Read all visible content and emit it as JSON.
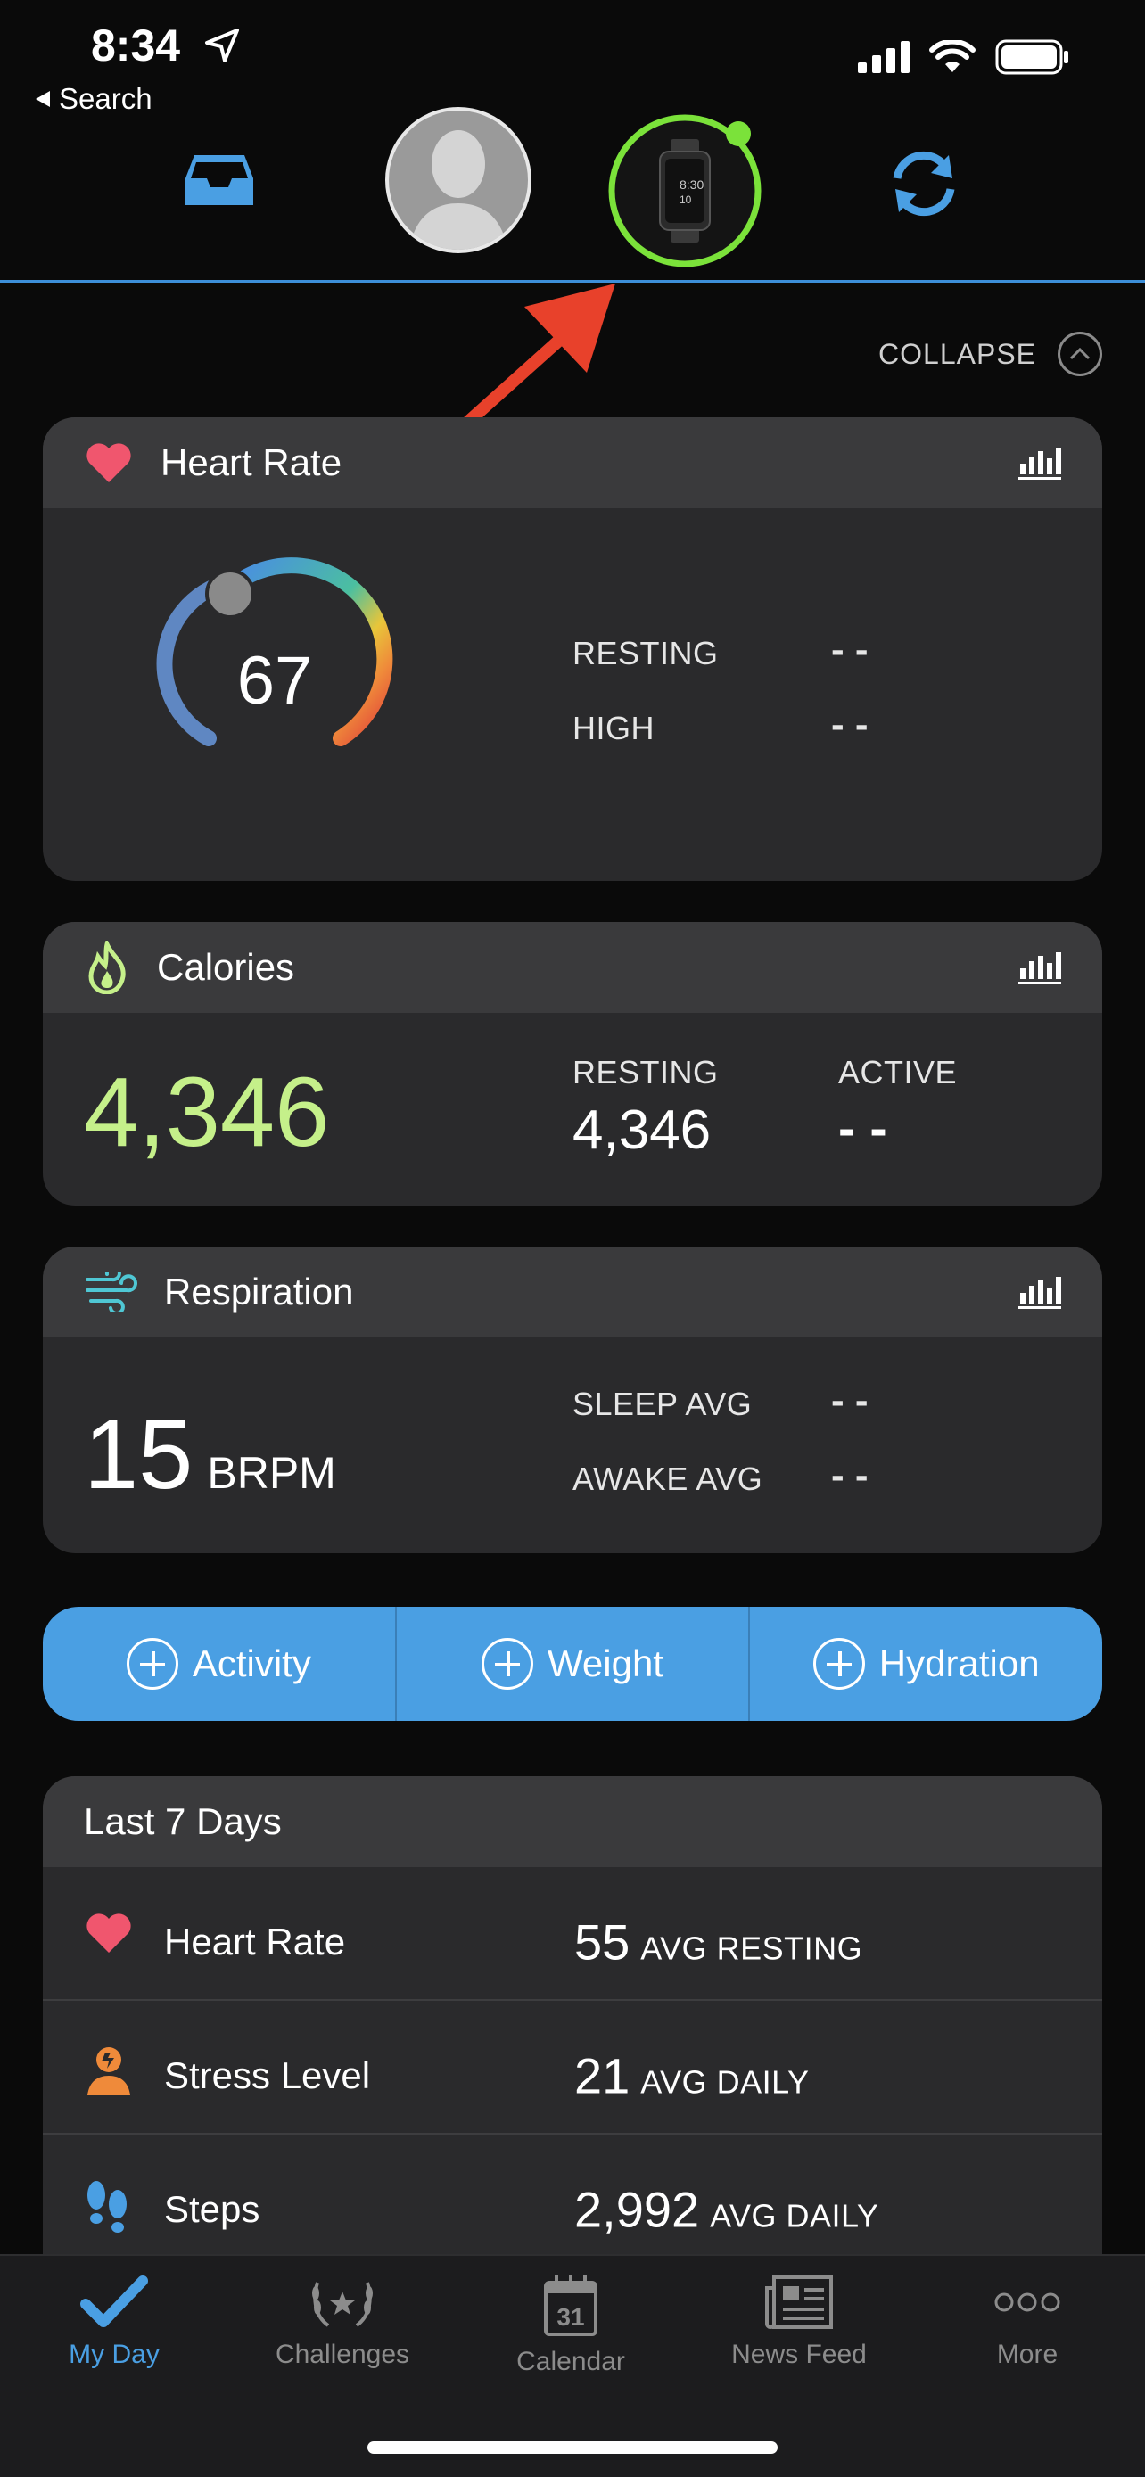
{
  "status": {
    "time": "8:34",
    "back_label": "Search"
  },
  "collapse_label": "COLLAPSE",
  "heart_rate": {
    "title": "Heart Rate",
    "current": "67",
    "resting_label": "RESTING",
    "resting_value": "- -",
    "high_label": "HIGH",
    "high_value": "- -"
  },
  "calories": {
    "title": "Calories",
    "total": "4,346",
    "resting_label": "RESTING",
    "resting_value": "4,346",
    "active_label": "ACTIVE",
    "active_value": "- -"
  },
  "respiration": {
    "title": "Respiration",
    "value": "15",
    "unit": "BRPM",
    "sleep_label": "SLEEP AVG",
    "sleep_value": "- -",
    "awake_label": "AWAKE AVG",
    "awake_value": "- -"
  },
  "quick_add": [
    "Activity",
    "Weight",
    "Hydration"
  ],
  "last7": {
    "title": "Last 7 Days",
    "rows": [
      {
        "label": "Heart Rate",
        "value": "55",
        "unit": "AVG RESTING",
        "icon": "heart-icon"
      },
      {
        "label": "Stress Level",
        "value": "21",
        "unit": "AVG DAILY",
        "icon": "stress-icon"
      },
      {
        "label": "Steps",
        "value": "2,992",
        "unit": "AVG DAILY",
        "icon": "footsteps-icon"
      }
    ]
  },
  "tabs": [
    {
      "label": "My Day",
      "icon": "checkmark-icon"
    },
    {
      "label": "Challenges",
      "icon": "laurel-icon"
    },
    {
      "label": "Calendar",
      "icon": "calendar-icon",
      "calendar_day": "31"
    },
    {
      "label": "News Feed",
      "icon": "newspaper-icon"
    },
    {
      "label": "More",
      "icon": "more-icon"
    }
  ],
  "colors": {
    "accent": "#4a9fe3",
    "calories_green": "#c5f08a",
    "heart_red": "#f0566e",
    "device_ring": "#7be23a",
    "annotation_arrow": "#e8412b"
  }
}
